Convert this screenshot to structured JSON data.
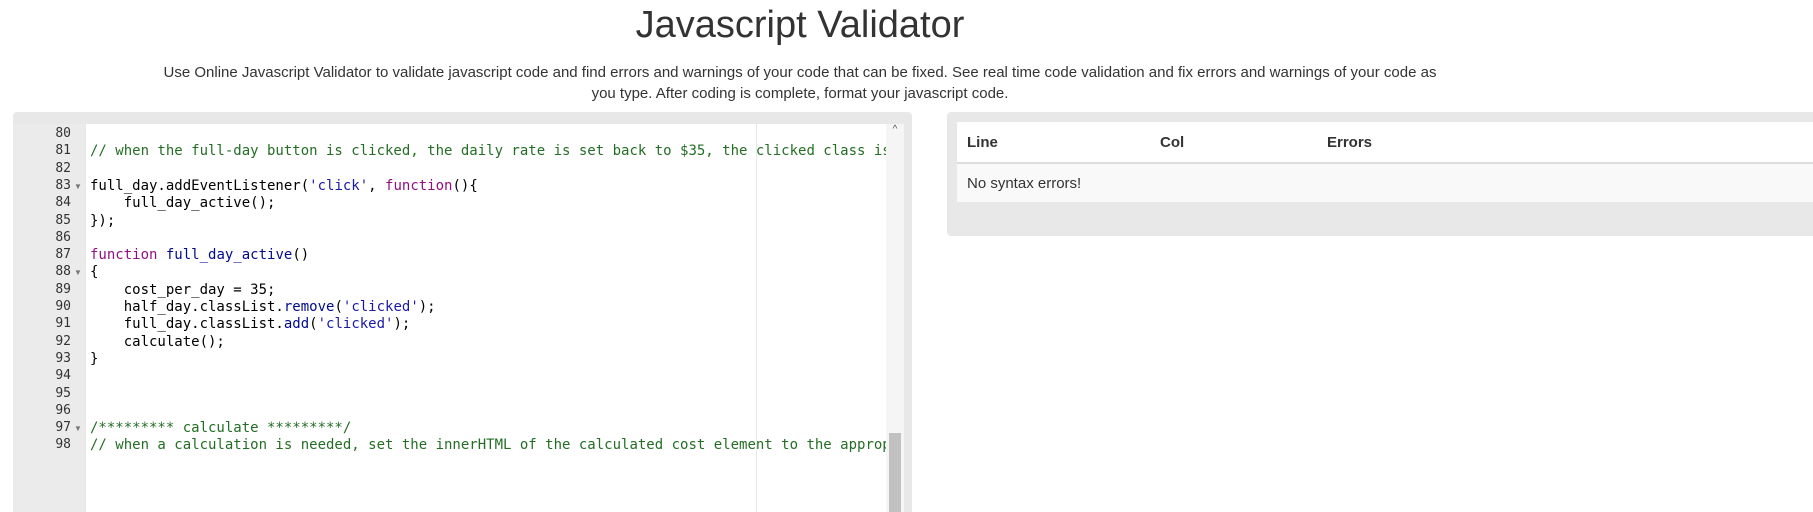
{
  "header": {
    "title": "Javascript Validator",
    "description": "Use Online Javascript Validator to validate javascript code and find errors and warnings of your code that can be fixed. See real time code validation and fix errors and warnings of your code as you type. After coding is complete, format your javascript code."
  },
  "editor": {
    "lines": [
      {
        "n": "80",
        "text": ""
      },
      {
        "n": "81",
        "text": "// when the full-day button is clicked, the daily rate is set back to $35, the clicked class is"
      },
      {
        "n": "82",
        "text": ""
      },
      {
        "n": "83",
        "text": "full_day.addEventListener('click', function(){",
        "fold": true
      },
      {
        "n": "84",
        "text": "    full_day_active();"
      },
      {
        "n": "85",
        "text": "});"
      },
      {
        "n": "86",
        "text": ""
      },
      {
        "n": "87",
        "text": "function full_day_active()"
      },
      {
        "n": "88",
        "text": "{",
        "fold": true
      },
      {
        "n": "89",
        "text": "    cost_per_day = 35;"
      },
      {
        "n": "90",
        "text": "    half_day.classList.remove('clicked');"
      },
      {
        "n": "91",
        "text": "    full_day.classList.add('clicked');"
      },
      {
        "n": "92",
        "text": "    calculate();"
      },
      {
        "n": "93",
        "text": "}"
      },
      {
        "n": "94",
        "text": ""
      },
      {
        "n": "95",
        "text": ""
      },
      {
        "n": "96",
        "text": ""
      },
      {
        "n": "97",
        "text": "/********* calculate *********/",
        "fold": true
      },
      {
        "n": "98",
        "text": "// when a calculation is needed, set the innerHTML of the calculated cost element to the appropr"
      }
    ],
    "scroll_position": 0.95
  },
  "results": {
    "columns": [
      "Line",
      "Col",
      "Errors"
    ],
    "message": "No syntax errors!"
  },
  "colors": {
    "comment": "#236e24",
    "string": "#1a1aa6",
    "keyword": "#930f80",
    "function": "#000a8c",
    "number": "#0000cd"
  }
}
